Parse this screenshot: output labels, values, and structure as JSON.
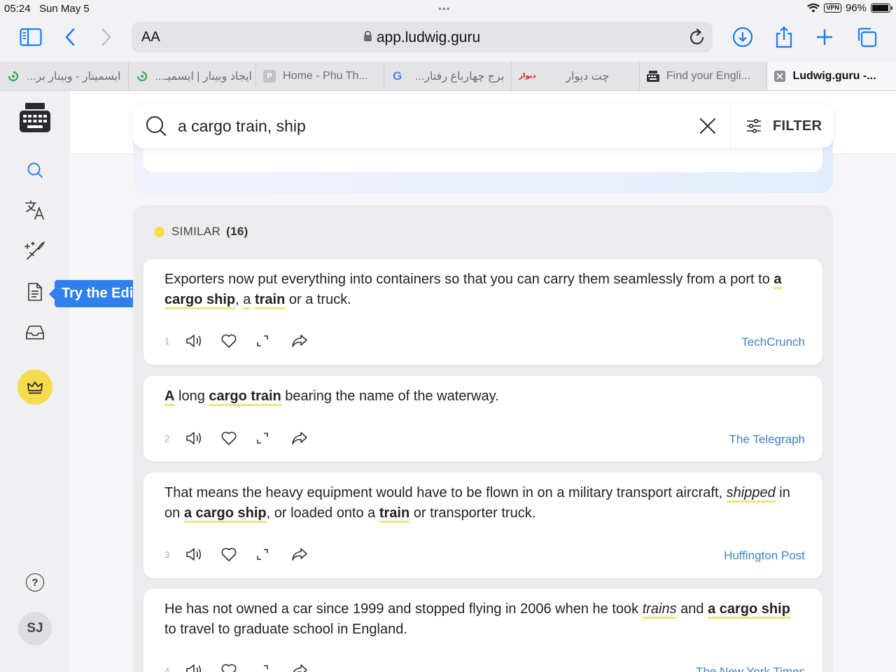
{
  "status_bar": {
    "time": "05:24",
    "date": "Sun May 5",
    "vpn": "VPN",
    "battery": "96%",
    "battery_level": 0.96
  },
  "toolbar": {
    "text_size_label": "AA",
    "url": "app.ludwig.guru"
  },
  "tabs": [
    {
      "label": "ایسمینار - وبینار بر...",
      "favicon": "eseminar-icon",
      "rtl": true
    },
    {
      "label": "ایجاد وبینار | ایسمیـ...",
      "favicon": "eseminar-icon",
      "rtl": true
    },
    {
      "label": "Home - Phu Th...",
      "favicon": "p-letter-icon",
      "rtl": false
    },
    {
      "label": "برج چهارباغ رفتار...",
      "favicon": "google-icon",
      "rtl": true
    },
    {
      "label": "چت دیوار",
      "favicon": "divar-icon",
      "favicon_text": "دیوار",
      "rtl": true
    },
    {
      "label": "Find your Engli...",
      "favicon": "typewriter-icon",
      "rtl": false
    },
    {
      "label": "Ludwig.guru -...",
      "favicon": "close-icon",
      "rtl": false,
      "active": true
    }
  ],
  "sidebar": {
    "avatar_initials": "SJ",
    "help_label": "?",
    "premium_color": "#f6dc4b"
  },
  "tooltip": {
    "label": "Try the Editor!"
  },
  "search": {
    "query": "a cargo train, ship",
    "filter_label": "FILTER"
  },
  "section": {
    "label": "SIMILAR",
    "count": "(16)",
    "dot_color": "#f6dc4b"
  },
  "results": [
    {
      "num": "1",
      "source": "TechCrunch",
      "parts": [
        {
          "t": "Exporters now put everything into containers so that you can carry them seamlessly from a port to "
        },
        {
          "t": "a cargo ship",
          "s": "b"
        },
        {
          "t": ", "
        },
        {
          "t": "a",
          "s": "n"
        },
        {
          "t": " "
        },
        {
          "t": "train",
          "s": "b"
        },
        {
          "t": " or a truck."
        }
      ]
    },
    {
      "num": "2",
      "source": "The Telegraph",
      "parts": [
        {
          "t": "A",
          "s": "b"
        },
        {
          "t": " long "
        },
        {
          "t": "cargo train",
          "s": "b"
        },
        {
          "t": " bearing the name of the waterway."
        }
      ]
    },
    {
      "num": "3",
      "source": "Huffington Post",
      "parts": [
        {
          "t": "That means the heavy equipment would have to be flown in on a military transport aircraft, "
        },
        {
          "t": "shipped",
          "s": "i"
        },
        {
          "t": " in on "
        },
        {
          "t": "a cargo ship",
          "s": "b"
        },
        {
          "t": ", or loaded onto a "
        },
        {
          "t": "train",
          "s": "b"
        },
        {
          "t": " or transporter truck."
        }
      ]
    },
    {
      "num": "4",
      "source": "The New York Times",
      "parts": [
        {
          "t": "He has not owned a car since 1999 and stopped flying in 2006 when he took "
        },
        {
          "t": "trains",
          "s": "i"
        },
        {
          "t": " and "
        },
        {
          "t": "a cargo ship",
          "s": "b"
        },
        {
          "t": " to travel to graduate school in England."
        }
      ]
    }
  ],
  "colors": {
    "accent_blue": "#2f80ed",
    "source_link": "#3b82c4",
    "highlight_underline": "#f4e27c",
    "toolbar_blue": "#1a7cf5"
  }
}
